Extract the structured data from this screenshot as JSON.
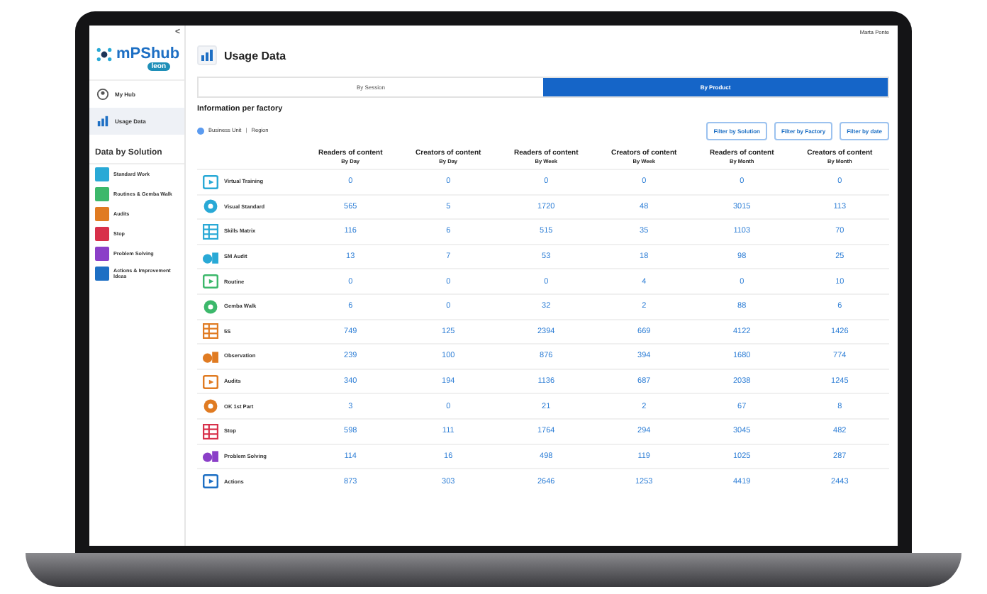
{
  "sidebar": {
    "collapse": "<",
    "logo": {
      "name": "mPShub",
      "sub": "leon"
    },
    "nav": [
      {
        "label": "My Hub",
        "selected": false
      },
      {
        "label": "Usage Data",
        "selected": true
      }
    ],
    "section_title": "Data by Solution",
    "solutions": [
      {
        "label": "Standard Work",
        "color": "#29a9d6"
      },
      {
        "label": "Routines & Gemba Walk",
        "color": "#3cb86b"
      },
      {
        "label": "Audits",
        "color": "#e07b22"
      },
      {
        "label": "Stop",
        "color": "#d8304a"
      },
      {
        "label": "Problem Solving",
        "color": "#8b3fc8"
      },
      {
        "label": "Actions & Improvement Ideas",
        "color": "#1d6fc4"
      }
    ]
  },
  "header": {
    "user": "Marta Ponte",
    "title": "Usage Data"
  },
  "tabs": [
    {
      "label": "By Session",
      "selected": false
    },
    {
      "label": "By Product",
      "selected": true
    }
  ],
  "section_title": "Information per factory",
  "breadcrumb": [
    "Business Unit",
    "Region"
  ],
  "breadcrumb_separator": "|",
  "filters": [
    "Filter by Solution",
    "Filter by Factory",
    "Filter by date"
  ],
  "table": {
    "columns": [
      {
        "title": "Readers of content",
        "sub": "By Day"
      },
      {
        "title": "Creators of content",
        "sub": "By Day"
      },
      {
        "title": "Readers of content",
        "sub": "By Week"
      },
      {
        "title": "Creators of content",
        "sub": "By Week"
      },
      {
        "title": "Readers of content",
        "sub": "By Month"
      },
      {
        "title": "Creators of content",
        "sub": "By Month"
      }
    ],
    "rows": [
      {
        "name": "Virtual Training",
        "color": "#29a9d6",
        "values": [
          "0",
          "0",
          "0",
          "0",
          "0",
          "0"
        ]
      },
      {
        "name": "Visual Standard",
        "color": "#29a9d6",
        "values": [
          "565",
          "5",
          "1720",
          "48",
          "3015",
          "113"
        ]
      },
      {
        "name": "Skills Matrix",
        "color": "#29a9d6",
        "values": [
          "116",
          "6",
          "515",
          "35",
          "1103",
          "70"
        ]
      },
      {
        "name": "SM Audit",
        "color": "#29a9d6",
        "values": [
          "13",
          "7",
          "53",
          "18",
          "98",
          "25"
        ]
      },
      {
        "name": "Routine",
        "color": "#3cb86b",
        "values": [
          "0",
          "0",
          "0",
          "4",
          "0",
          "10"
        ]
      },
      {
        "name": "Gemba Walk",
        "color": "#3cb86b",
        "values": [
          "6",
          "0",
          "32",
          "2",
          "88",
          "6"
        ]
      },
      {
        "name": "5S",
        "color": "#e07b22",
        "values": [
          "749",
          "125",
          "2394",
          "669",
          "4122",
          "1426"
        ]
      },
      {
        "name": "Observation",
        "color": "#e07b22",
        "values": [
          "239",
          "100",
          "876",
          "394",
          "1680",
          "774"
        ]
      },
      {
        "name": "Audits",
        "color": "#e07b22",
        "values": [
          "340",
          "194",
          "1136",
          "687",
          "2038",
          "1245"
        ]
      },
      {
        "name": "OK 1st Part",
        "color": "#e07b22",
        "values": [
          "3",
          "0",
          "21",
          "2",
          "67",
          "8"
        ]
      },
      {
        "name": "Stop",
        "color": "#d8304a",
        "values": [
          "598",
          "111",
          "1764",
          "294",
          "3045",
          "482"
        ]
      },
      {
        "name": "Problem Solving",
        "color": "#8b3fc8",
        "values": [
          "114",
          "16",
          "498",
          "119",
          "1025",
          "287"
        ]
      },
      {
        "name": "Actions",
        "color": "#1d6fc4",
        "values": [
          "873",
          "303",
          "2646",
          "1253",
          "4419",
          "2443"
        ]
      }
    ]
  }
}
